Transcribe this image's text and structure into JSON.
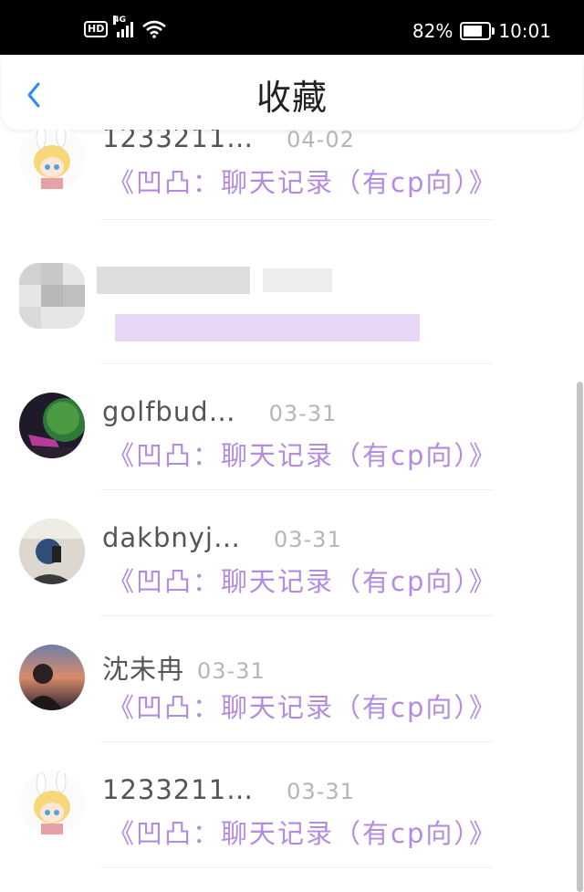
{
  "status_bar": {
    "hd": "HD",
    "network": "4G",
    "battery": "82%",
    "battery_level": 0.82,
    "time": "10:01"
  },
  "header": {
    "title": "收藏"
  },
  "colors": {
    "link": "#b38be0",
    "back": "#2d8cf0",
    "name": "#555555",
    "date": "#b5b5b5"
  },
  "items": [
    {
      "name": "1233211…",
      "date": "04-02",
      "link": "《凹凸：聊天记录（有cp向）》",
      "avatar": "anime-avatar"
    },
    {
      "name": "",
      "date": "",
      "link": "",
      "avatar": "blurred-avatar"
    },
    {
      "name": "golfbud…",
      "date": "03-31",
      "link": "《凹凸：聊天记录（有cp向）》",
      "avatar": "green-ball-avatar"
    },
    {
      "name": "dakbnyj…",
      "date": "03-31",
      "link": "《凹凸：聊天记录（有cp向）》",
      "avatar": "selfie-avatar"
    },
    {
      "name": "沈未冉",
      "date": "03-31",
      "link": "《凹凸：聊天记录（有cp向）》",
      "avatar": "sunset-avatar"
    },
    {
      "name": "1233211…",
      "date": "03-31",
      "link": "《凹凸：聊天记录（有cp向）》",
      "avatar": "anime-avatar"
    }
  ]
}
